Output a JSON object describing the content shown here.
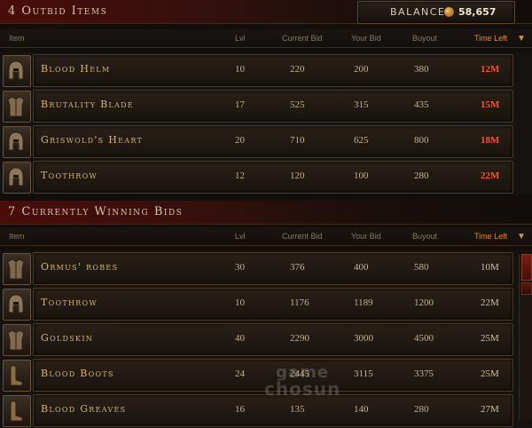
{
  "balance": {
    "label": "BALANCE:",
    "value": "58,657"
  },
  "outbid": {
    "title": "4 Outbid Items",
    "headers": {
      "item": "Item",
      "lvl": "Lvl",
      "current": "Current Bid",
      "yours": "Your Bid",
      "buyout": "Buyout",
      "time": "Time Left"
    },
    "rows": [
      {
        "name": "Blood Helm",
        "lvl": "10",
        "current": "220",
        "yours": "200",
        "buyout": "380",
        "time": "12M",
        "icon": "helm-icon"
      },
      {
        "name": "Brutality Blade",
        "lvl": "17",
        "current": "525",
        "yours": "315",
        "buyout": "435",
        "time": "15M",
        "icon": "armor-icon"
      },
      {
        "name": "Griswold's Heart",
        "lvl": "20",
        "current": "710",
        "yours": "625",
        "buyout": "800",
        "time": "18M",
        "icon": "helm-icon"
      },
      {
        "name": "Toothrow",
        "lvl": "12",
        "current": "120",
        "yours": "100",
        "buyout": "280",
        "time": "22M",
        "icon": "helm-icon"
      }
    ]
  },
  "winning": {
    "title": "7 Currently Winning Bids",
    "headers": {
      "item": "Item",
      "lvl": "Lvl",
      "current": "Current Bid",
      "yours": "Your Bid",
      "buyout": "Buyout",
      "time": "Time Left"
    },
    "rows": [
      {
        "name": "Ormus' robes",
        "lvl": "30",
        "current": "376",
        "yours": "400",
        "buyout": "580",
        "time": "10M",
        "icon": "armor-icon"
      },
      {
        "name": "Toothrow",
        "lvl": "10",
        "current": "1176",
        "yours": "1189",
        "buyout": "1200",
        "time": "22M",
        "icon": "helm-icon"
      },
      {
        "name": "Goldskin",
        "lvl": "40",
        "current": "2290",
        "yours": "3000",
        "buyout": "4500",
        "time": "25M",
        "icon": "armor-icon"
      },
      {
        "name": "Blood Boots",
        "lvl": "24",
        "current": "2445",
        "yours": "3115",
        "buyout": "3375",
        "time": "25M",
        "icon": "boots-icon"
      },
      {
        "name": "Blood Greaves",
        "lvl": "16",
        "current": "135",
        "yours": "140",
        "buyout": "280",
        "time": "27M",
        "icon": "boots-icon"
      }
    ]
  },
  "watermark": {
    "line1": "game",
    "line2": "chosun"
  }
}
